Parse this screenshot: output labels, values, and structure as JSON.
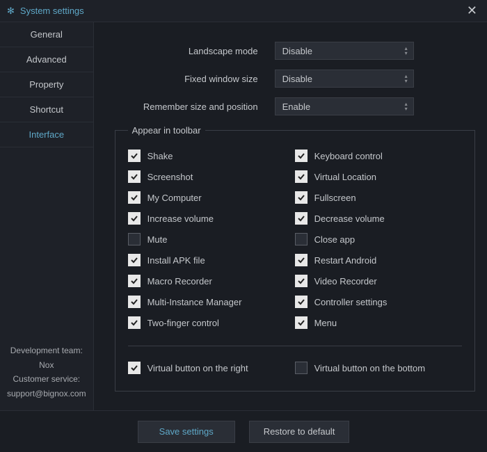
{
  "titlebar": {
    "title": "System settings"
  },
  "sidebar": {
    "tabs": [
      {
        "label": "General"
      },
      {
        "label": "Advanced"
      },
      {
        "label": "Property"
      },
      {
        "label": "Shortcut"
      },
      {
        "label": "Interface"
      }
    ],
    "footer": {
      "dev_team": "Development team: Nox",
      "customer_service": "Customer service:",
      "email": "support@bignox.com"
    }
  },
  "form": {
    "landscape_mode": {
      "label": "Landscape mode",
      "value": "Disable"
    },
    "fixed_window_size": {
      "label": "Fixed window size",
      "value": "Disable"
    },
    "remember_size": {
      "label": "Remember size and position",
      "value": "Enable"
    }
  },
  "toolbar_fieldset": {
    "legend": "Appear in toolbar",
    "left": [
      {
        "label": "Shake",
        "checked": true
      },
      {
        "label": "Screenshot",
        "checked": true
      },
      {
        "label": "My Computer",
        "checked": true
      },
      {
        "label": "Increase volume",
        "checked": true
      },
      {
        "label": "Mute",
        "checked": false
      },
      {
        "label": "Install APK file",
        "checked": true
      },
      {
        "label": "Macro Recorder",
        "checked": true
      },
      {
        "label": "Multi-Instance Manager",
        "checked": true
      },
      {
        "label": "Two-finger control",
        "checked": true
      }
    ],
    "right": [
      {
        "label": "Keyboard control",
        "checked": true
      },
      {
        "label": "Virtual Location",
        "checked": true
      },
      {
        "label": "Fullscreen",
        "checked": true
      },
      {
        "label": "Decrease volume",
        "checked": true
      },
      {
        "label": "Close app",
        "checked": false
      },
      {
        "label": "Restart Android",
        "checked": true
      },
      {
        "label": "Video Recorder",
        "checked": true
      },
      {
        "label": "Controller settings",
        "checked": true
      },
      {
        "label": "Menu",
        "checked": true
      }
    ],
    "virtual_right": {
      "label": "Virtual button on the right",
      "checked": true
    },
    "virtual_bottom": {
      "label": "Virtual button on the bottom",
      "checked": false
    }
  },
  "footer": {
    "save": "Save settings",
    "restore": "Restore to default"
  }
}
